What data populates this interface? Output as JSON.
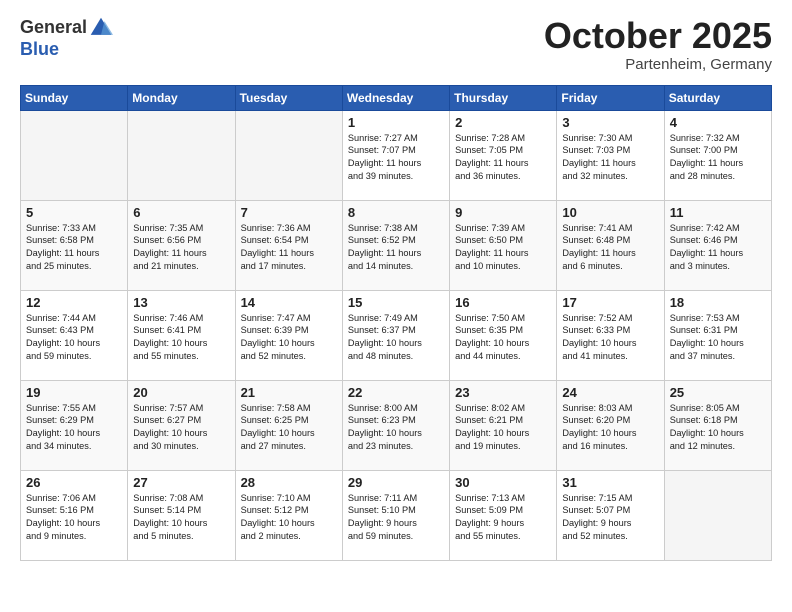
{
  "header": {
    "logo_general": "General",
    "logo_blue": "Blue",
    "title": "October 2025",
    "subtitle": "Partenheim, Germany"
  },
  "weekdays": [
    "Sunday",
    "Monday",
    "Tuesday",
    "Wednesday",
    "Thursday",
    "Friday",
    "Saturday"
  ],
  "weeks": [
    [
      {
        "day": "",
        "info": ""
      },
      {
        "day": "",
        "info": ""
      },
      {
        "day": "",
        "info": ""
      },
      {
        "day": "1",
        "info": "Sunrise: 7:27 AM\nSunset: 7:07 PM\nDaylight: 11 hours\nand 39 minutes."
      },
      {
        "day": "2",
        "info": "Sunrise: 7:28 AM\nSunset: 7:05 PM\nDaylight: 11 hours\nand 36 minutes."
      },
      {
        "day": "3",
        "info": "Sunrise: 7:30 AM\nSunset: 7:03 PM\nDaylight: 11 hours\nand 32 minutes."
      },
      {
        "day": "4",
        "info": "Sunrise: 7:32 AM\nSunset: 7:00 PM\nDaylight: 11 hours\nand 28 minutes."
      }
    ],
    [
      {
        "day": "5",
        "info": "Sunrise: 7:33 AM\nSunset: 6:58 PM\nDaylight: 11 hours\nand 25 minutes."
      },
      {
        "day": "6",
        "info": "Sunrise: 7:35 AM\nSunset: 6:56 PM\nDaylight: 11 hours\nand 21 minutes."
      },
      {
        "day": "7",
        "info": "Sunrise: 7:36 AM\nSunset: 6:54 PM\nDaylight: 11 hours\nand 17 minutes."
      },
      {
        "day": "8",
        "info": "Sunrise: 7:38 AM\nSunset: 6:52 PM\nDaylight: 11 hours\nand 14 minutes."
      },
      {
        "day": "9",
        "info": "Sunrise: 7:39 AM\nSunset: 6:50 PM\nDaylight: 11 hours\nand 10 minutes."
      },
      {
        "day": "10",
        "info": "Sunrise: 7:41 AM\nSunset: 6:48 PM\nDaylight: 11 hours\nand 6 minutes."
      },
      {
        "day": "11",
        "info": "Sunrise: 7:42 AM\nSunset: 6:46 PM\nDaylight: 11 hours\nand 3 minutes."
      }
    ],
    [
      {
        "day": "12",
        "info": "Sunrise: 7:44 AM\nSunset: 6:43 PM\nDaylight: 10 hours\nand 59 minutes."
      },
      {
        "day": "13",
        "info": "Sunrise: 7:46 AM\nSunset: 6:41 PM\nDaylight: 10 hours\nand 55 minutes."
      },
      {
        "day": "14",
        "info": "Sunrise: 7:47 AM\nSunset: 6:39 PM\nDaylight: 10 hours\nand 52 minutes."
      },
      {
        "day": "15",
        "info": "Sunrise: 7:49 AM\nSunset: 6:37 PM\nDaylight: 10 hours\nand 48 minutes."
      },
      {
        "day": "16",
        "info": "Sunrise: 7:50 AM\nSunset: 6:35 PM\nDaylight: 10 hours\nand 44 minutes."
      },
      {
        "day": "17",
        "info": "Sunrise: 7:52 AM\nSunset: 6:33 PM\nDaylight: 10 hours\nand 41 minutes."
      },
      {
        "day": "18",
        "info": "Sunrise: 7:53 AM\nSunset: 6:31 PM\nDaylight: 10 hours\nand 37 minutes."
      }
    ],
    [
      {
        "day": "19",
        "info": "Sunrise: 7:55 AM\nSunset: 6:29 PM\nDaylight: 10 hours\nand 34 minutes."
      },
      {
        "day": "20",
        "info": "Sunrise: 7:57 AM\nSunset: 6:27 PM\nDaylight: 10 hours\nand 30 minutes."
      },
      {
        "day": "21",
        "info": "Sunrise: 7:58 AM\nSunset: 6:25 PM\nDaylight: 10 hours\nand 27 minutes."
      },
      {
        "day": "22",
        "info": "Sunrise: 8:00 AM\nSunset: 6:23 PM\nDaylight: 10 hours\nand 23 minutes."
      },
      {
        "day": "23",
        "info": "Sunrise: 8:02 AM\nSunset: 6:21 PM\nDaylight: 10 hours\nand 19 minutes."
      },
      {
        "day": "24",
        "info": "Sunrise: 8:03 AM\nSunset: 6:20 PM\nDaylight: 10 hours\nand 16 minutes."
      },
      {
        "day": "25",
        "info": "Sunrise: 8:05 AM\nSunset: 6:18 PM\nDaylight: 10 hours\nand 12 minutes."
      }
    ],
    [
      {
        "day": "26",
        "info": "Sunrise: 7:06 AM\nSunset: 5:16 PM\nDaylight: 10 hours\nand 9 minutes."
      },
      {
        "day": "27",
        "info": "Sunrise: 7:08 AM\nSunset: 5:14 PM\nDaylight: 10 hours\nand 5 minutes."
      },
      {
        "day": "28",
        "info": "Sunrise: 7:10 AM\nSunset: 5:12 PM\nDaylight: 10 hours\nand 2 minutes."
      },
      {
        "day": "29",
        "info": "Sunrise: 7:11 AM\nSunset: 5:10 PM\nDaylight: 9 hours\nand 59 minutes."
      },
      {
        "day": "30",
        "info": "Sunrise: 7:13 AM\nSunset: 5:09 PM\nDaylight: 9 hours\nand 55 minutes."
      },
      {
        "day": "31",
        "info": "Sunrise: 7:15 AM\nSunset: 5:07 PM\nDaylight: 9 hours\nand 52 minutes."
      },
      {
        "day": "",
        "info": ""
      }
    ]
  ]
}
